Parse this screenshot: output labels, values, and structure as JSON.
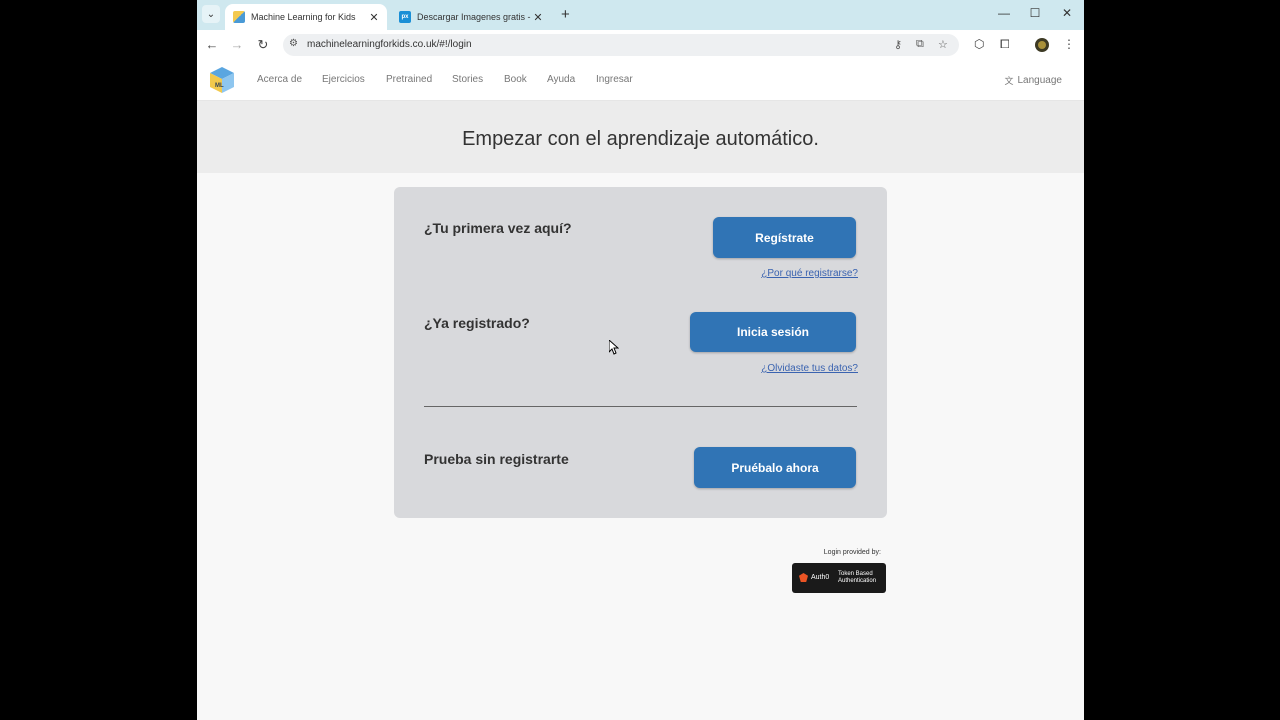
{
  "browser": {
    "tabs": [
      {
        "title": "Machine Learning for Kids",
        "active": true
      },
      {
        "title": "Descargar Imagenes gratis - Pix",
        "active": false
      }
    ],
    "url": "machinelearningforkids.co.uk/#!/login"
  },
  "site_nav": {
    "logo": "ML",
    "links": [
      "Acerca de",
      "Ejercicios",
      "Pretrained",
      "Stories",
      "Book",
      "Ayuda",
      "Ingresar"
    ],
    "language": "Language"
  },
  "hero": {
    "title": "Empezar con el aprendizaje automático."
  },
  "login_card": {
    "first_time": {
      "question": "¿Tu primera vez aquí?",
      "button": "Regístrate",
      "link": "¿Por qué registrarse?"
    },
    "registered": {
      "question": "¿Ya registrado?",
      "button": "Inicia sesión",
      "link": "¿Olvidaste tus datos?"
    },
    "try": {
      "question": "Prueba sin registrarte",
      "button": "Pruébalo ahora"
    }
  },
  "auth": {
    "provided_by": "Login provided by:",
    "brand": "Auth0",
    "tagline_1": "Token Based",
    "tagline_2": "Authentication"
  },
  "colors": {
    "primary_button": "#3074b5",
    "tabstrip": "#cfe8ef",
    "card": "#d8d9dc"
  }
}
